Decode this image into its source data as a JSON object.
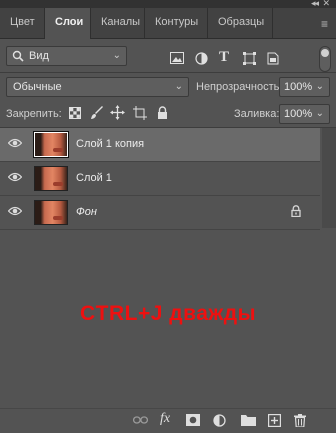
{
  "window": {
    "collapse_glyph": "◂◂",
    "close_glyph": "✕"
  },
  "tabs": [
    {
      "label": "Цвет",
      "active": false
    },
    {
      "label": "Слои",
      "active": true
    },
    {
      "label": "Каналы",
      "active": false
    },
    {
      "label": "Контуры",
      "active": false
    },
    {
      "label": "Образцы",
      "active": false
    }
  ],
  "panel_menu_glyph": "≡",
  "filter": {
    "kind_value": "Вид",
    "icons": [
      "image-filter-icon",
      "adjustment-filter-icon",
      "type-filter-icon",
      "shape-filter-icon",
      "smart-object-filter-icon"
    ]
  },
  "blend": {
    "mode_value": "Обычные",
    "opacity_label": "Непрозрачность:",
    "opacity_value": "100%"
  },
  "lock": {
    "label": "Закрепить:",
    "fill_label": "Заливка:",
    "fill_value": "100%"
  },
  "layers": [
    {
      "name": "Слой 1 копия",
      "selected": true,
      "visible": true,
      "locked": false,
      "italic": false
    },
    {
      "name": "Слой 1",
      "selected": false,
      "visible": true,
      "locked": false,
      "italic": false
    },
    {
      "name": "Фон",
      "selected": false,
      "visible": true,
      "locked": true,
      "italic": true
    }
  ],
  "overlay_text": "CTRL+J дважды",
  "colors": {
    "panel_bg": "#535353",
    "tab_bar_bg": "#424242",
    "selected_layer_bg": "#6a6a6a",
    "overlay_text": "#ee1010"
  },
  "bottom_bar": {
    "fx_label": "fx",
    "icons": [
      "link-layers-icon",
      "fx-icon",
      "add-mask-icon",
      "adjustment-layer-icon",
      "new-group-icon",
      "new-layer-icon",
      "delete-layer-icon"
    ]
  }
}
